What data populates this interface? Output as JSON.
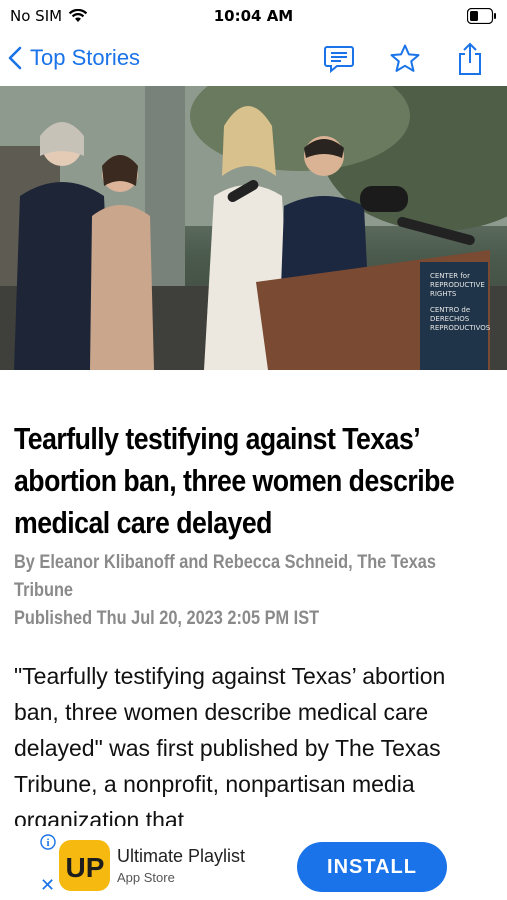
{
  "status_bar": {
    "carrier": "No SIM",
    "time": "10:04 AM",
    "icons": [
      "wifi-icon",
      "battery-icon"
    ]
  },
  "nav": {
    "back_label": "Top Stories",
    "icons": [
      "comment-icon",
      "star-icon",
      "share-icon"
    ],
    "accent": "#1a73e8"
  },
  "article": {
    "image_alt": "A woman speaks at a podium with microphones, with others standing behind her",
    "podium_sign": [
      "CENTER for",
      "REPRODUCTIVE",
      "RIGHTS",
      "CENTRO de",
      "DERECHOS",
      "REPRODUCTIVOS"
    ],
    "headline": "Tearfully testifying against Texas’ abortion ban, three women describe medical care delayed",
    "byline": "By Eleanor Klibanoff and Rebecca Schneid, The Texas Tribune",
    "published": "Published Thu Jul 20, 2023 2:05 PM IST",
    "body": "\"Tearfully testifying against Texas’ abortion ban, three women describe medical care delayed\" was first published by The Texas Tribune, a nonprofit, nonpartisan media organization that"
  },
  "ad": {
    "app_name": "Ultimate Playlist",
    "store": "App Store",
    "cta": "INSTALL",
    "logo_text": "UP",
    "close_glyph": "✕",
    "info_glyph": "i",
    "cta_color": "#1a73e8"
  }
}
